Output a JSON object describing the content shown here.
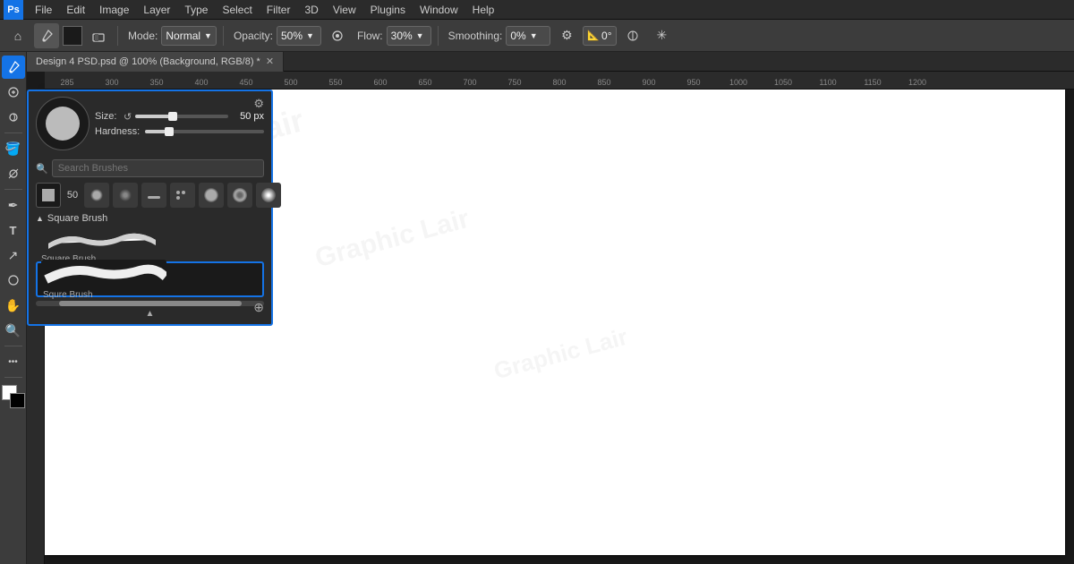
{
  "app": {
    "title": "Adobe Photoshop",
    "logo": "Ps"
  },
  "menu": {
    "items": [
      "File",
      "Edit",
      "Image",
      "Layer",
      "Type",
      "Select",
      "Filter",
      "3D",
      "View",
      "Plugins",
      "Window",
      "Help"
    ]
  },
  "toolbar": {
    "mode_label": "Mode:",
    "mode_value": "Normal",
    "opacity_label": "Opacity:",
    "opacity_value": "50%",
    "flow_label": "Flow:",
    "flow_value": "30%",
    "smoothing_label": "Smoothing:",
    "smoothing_value": "0%",
    "angle_value": "0°"
  },
  "tab": {
    "title": "Design 4 PSD.psd @ 100% (Background, RGB/8) *"
  },
  "ruler": {
    "ticks": [
      "285",
      "300",
      "350",
      "400",
      "450",
      "500",
      "550",
      "600",
      "650",
      "700",
      "750",
      "800",
      "850",
      "900",
      "950",
      "1000",
      "1050",
      "1100",
      "1150",
      "1200"
    ]
  },
  "brush_popup": {
    "size_label": "Size:",
    "size_value": "50 px",
    "hardness_label": "Hardness:",
    "hardness_value": "",
    "size_fill_pct": 40,
    "hardness_fill_pct": 20,
    "search_placeholder": "Search Brushes",
    "settings_icon": "⚙",
    "type_icons": [
      {
        "label": "50",
        "shape": "square"
      },
      {
        "label": "",
        "shape": "circle"
      },
      {
        "label": "",
        "shape": "soft-circle"
      },
      {
        "label": "",
        "shape": "line"
      },
      {
        "label": "",
        "shape": "dots"
      },
      {
        "label": "",
        "shape": "large-circle"
      },
      {
        "label": "",
        "shape": "feather-circle"
      },
      {
        "label": "",
        "shape": "glow"
      }
    ],
    "groups": [
      {
        "name": "Square Brush",
        "expanded": true,
        "items": [
          {
            "name": "Square Brush",
            "selected": false
          },
          {
            "name": "Squre Brush",
            "selected": true
          }
        ]
      }
    ]
  },
  "tools": {
    "items": [
      "🪣",
      "◎",
      "🔍",
      "✏",
      "T",
      "↗",
      "⊙",
      "✋",
      "🔍",
      "•••"
    ]
  },
  "watermarks": [
    "Graphic Lair",
    "Graphic Lair",
    "Graphic Lair"
  ]
}
